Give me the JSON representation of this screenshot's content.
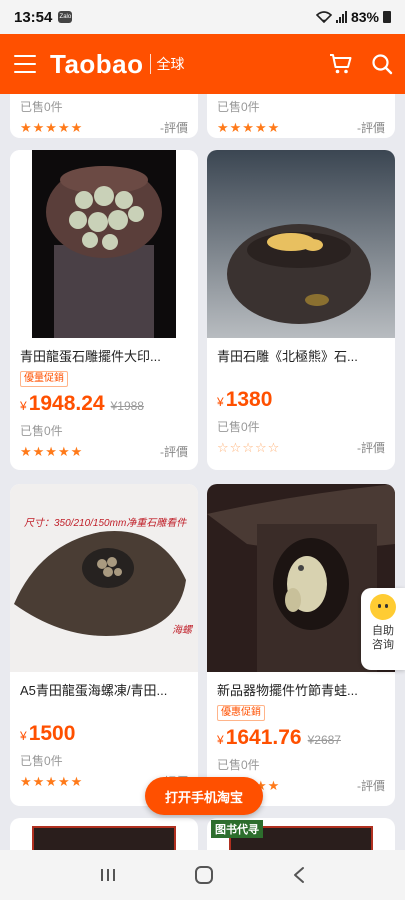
{
  "status": {
    "time": "13:54",
    "notif": "Zalo",
    "battery": "83%"
  },
  "header": {
    "brand": "Taobao",
    "region": "全球"
  },
  "top_partial": [
    {
      "sold": "已售0件",
      "stars": "★★★★★",
      "review": "-評價"
    },
    {
      "sold": "已售0件",
      "stars": "★★★★★",
      "review": "-評價"
    }
  ],
  "products": [
    {
      "title": "青田龍蛋石雕擺件大印...",
      "badge": "優量促銷",
      "currency": "¥",
      "price": "1948.24",
      "old_price": "¥1988",
      "sold": "已售0件",
      "stars": "★★★★★",
      "review": "-評價"
    },
    {
      "title": "青田石雕《北極熊》石...",
      "badge": "",
      "currency": "¥",
      "price": "1380",
      "old_price": "",
      "sold": "已售0件",
      "stars": "☆☆☆☆☆",
      "review": "-評價"
    },
    {
      "title": "A5青田龍蛋海螺凍/青田...",
      "badge": "",
      "currency": "¥",
      "price": "1500",
      "old_price": "",
      "sold": "已售0件",
      "stars": "★★★★★",
      "review": "-評價",
      "overlay_text": "尺寸：350/210/150mm净重石雕看件",
      "overlay_corner": "海螺"
    },
    {
      "title": "新品器物擺件竹節青蛙...",
      "badge": "優惠促銷",
      "currency": "¥",
      "price": "1641.76",
      "old_price": "¥2687",
      "sold": "已售0件",
      "stars": "★★★★★",
      "review": "-評價"
    }
  ],
  "bottom_partial": {
    "tag": "图书代寻"
  },
  "help": {
    "label_1": "自助",
    "label_2": "咨询"
  },
  "open_app": "打开手机淘宝",
  "colors": {
    "accent": "#ff5000",
    "background": "#e9eaef"
  }
}
